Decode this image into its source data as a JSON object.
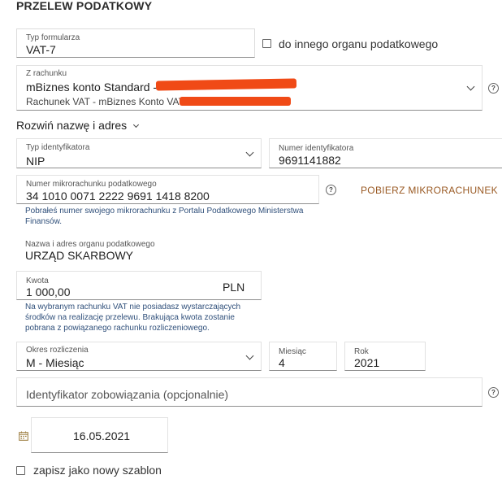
{
  "header": {
    "title": "PRZELEW PODATKOWY"
  },
  "form_type": {
    "label": "Typ formularza",
    "value": "VAT-7"
  },
  "other_office": {
    "label": "do innego organu podatkowego",
    "checked": false
  },
  "from_account": {
    "label": "Z rachunku",
    "line1": "mBiznes konto Standard -",
    "line2": "Rachunek VAT - mBiznes Konto VAT"
  },
  "expand_name": {
    "label": "Rozwiń nazwę i adres"
  },
  "id_type": {
    "label": "Typ identyfikatora",
    "value": "NIP"
  },
  "id_number": {
    "label": "Numer identyfikatora",
    "value": "9691141882"
  },
  "micro_account": {
    "label": "Numer mikrorachunku podatkowego",
    "value": "34 1010 0071 2222 9691 1418 8200",
    "button": "POBIERZ MIKRORACHUNEK",
    "note_line1": "Pobrałeś numer swojego mikrorachunku z Portalu Podatkowego Ministerstwa",
    "note_line2": "Finansów."
  },
  "office_name": {
    "label": "Nazwa i adres organu podatkowego",
    "value": "URZĄD SKARBOWY"
  },
  "amount": {
    "label": "Kwota",
    "value": "1 000,00",
    "currency": "PLN",
    "note_line1": "Na wybranym rachunku VAT nie posiadasz wystarczających",
    "note_line2": "środków na realizację przelewu. Brakująca kwota zostanie",
    "note_line3": "pobrana z powiązanego rachunku rozliczeniowego."
  },
  "period": {
    "label": "Okres rozliczenia",
    "value": "M - Miesiąc"
  },
  "month": {
    "label": "Miesiąc",
    "value": "4"
  },
  "year": {
    "label": "Rok",
    "value": "2021"
  },
  "obligation_id": {
    "placeholder": "Identyfikator zobowiązania (opcjonalnie)"
  },
  "date": {
    "value": "16.05.2021",
    "icon": "calendar-icon"
  },
  "save_template": {
    "label": "zapisz jako nowy szablon",
    "checked": false
  },
  "colors": {
    "redaction": "#f04a16",
    "link": "#9a5a24",
    "note": "#2f4f7a"
  }
}
